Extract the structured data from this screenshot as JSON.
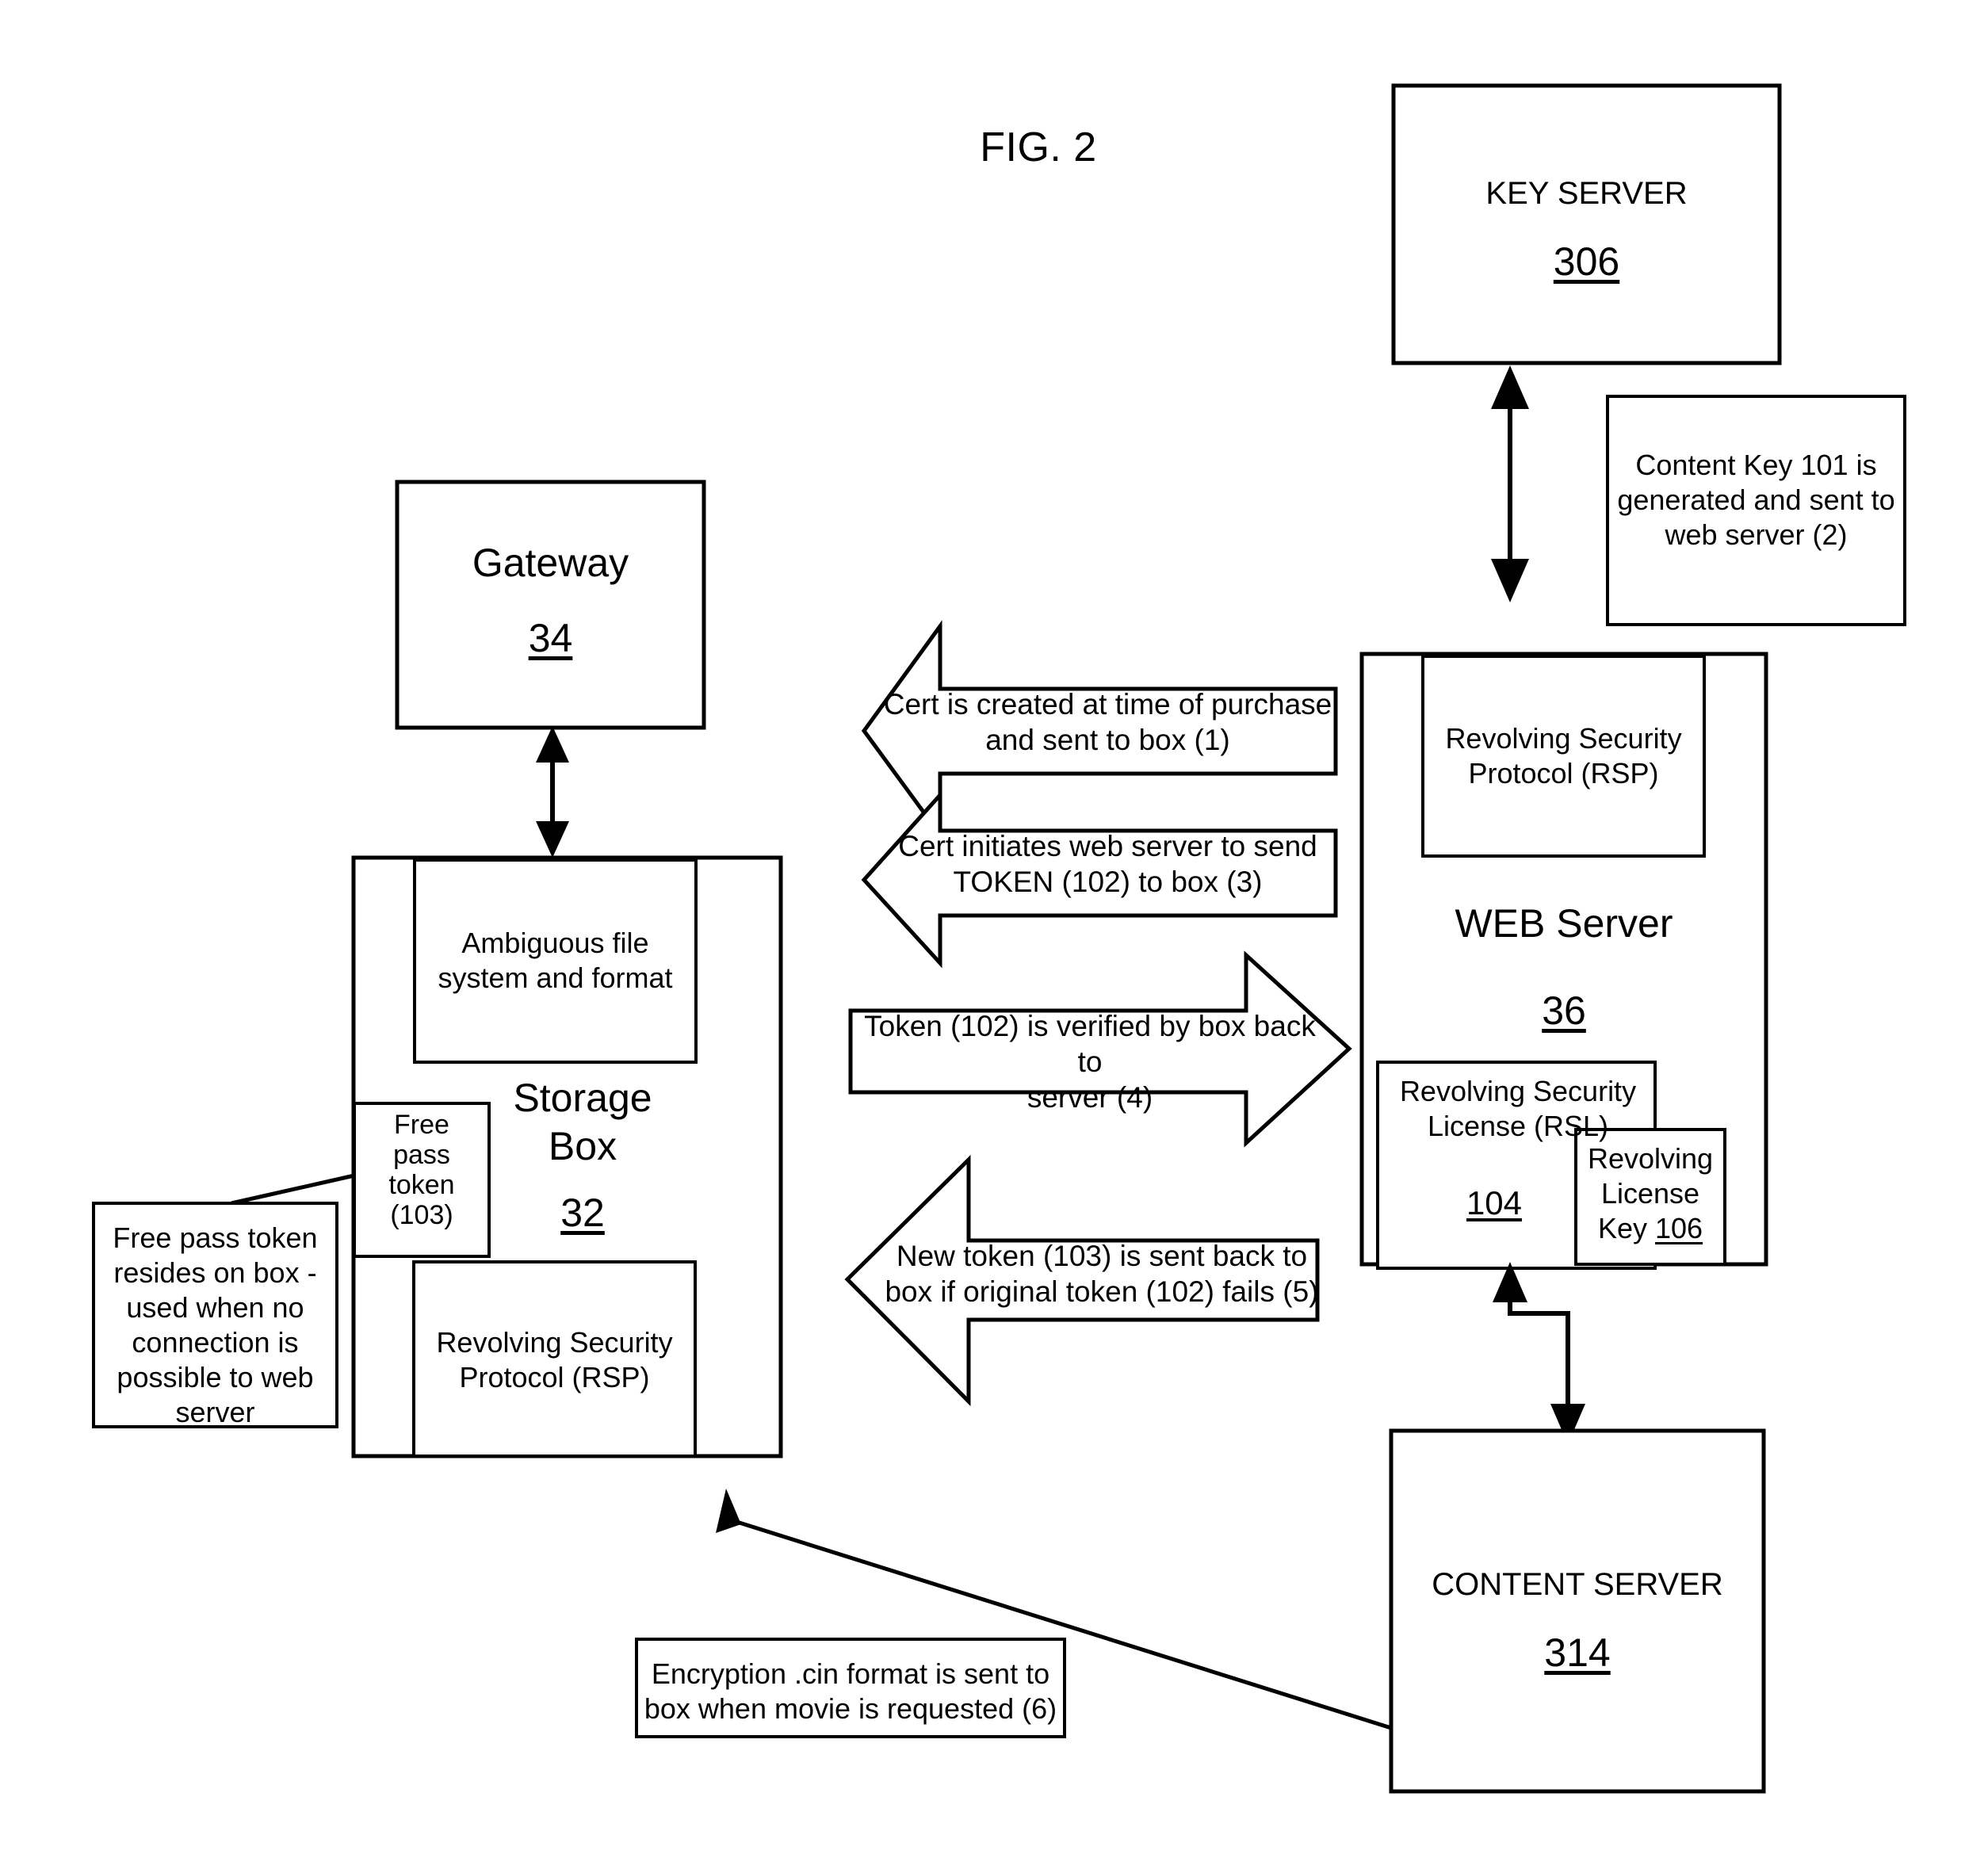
{
  "figure": {
    "title": "FIG. 2"
  },
  "nodes": {
    "key_server": {
      "label": "KEY SERVER",
      "ref": "306"
    },
    "gateway": {
      "label": "Gateway",
      "ref": "34"
    },
    "storage_box": {
      "label": "Storage\nBox",
      "ref": "32",
      "ambiguous_fs": "Ambiguous file\nsystem and format",
      "rsp": "Revolving Security\nProtocol (RSP)",
      "free_pass_token": "Free\npass\ntoken\n(103)"
    },
    "web_server": {
      "label": "WEB Server",
      "ref": "36",
      "rsp": "Revolving Security\nProtocol (RSP)",
      "rsl_label": "Revolving Security\nLicense (RSL)",
      "rsl_ref": "104",
      "license_key_label": "Revolving\nLicense\nKey ",
      "license_key_ref": "106"
    },
    "content_server": {
      "label": "CONTENT SERVER",
      "ref": "314"
    }
  },
  "notes": {
    "content_key": "Content Key 101 is\ngenerated and sent to\nweb server (2)",
    "free_pass": "Free pass token\nresides on box -\nused when no\nconnection is\npossible to web\nserver",
    "encryption": "Encryption .cin format is sent to\nbox when movie is requested (6)"
  },
  "flow_callouts": [
    {
      "step": "1",
      "direction": "left",
      "text": "Cert is created at time of purchase\nand sent to box (1)"
    },
    {
      "step": "3",
      "direction": "left",
      "text": "Cert initiates web server to send\nTOKEN (102) to box (3)"
    },
    {
      "step": "4",
      "direction": "right",
      "text": "Token (102) is verified by box back to\nserver (4)"
    },
    {
      "step": "5",
      "direction": "left",
      "text": "New token (103) is sent back to\nbox if original token (102) fails (5)"
    }
  ],
  "colors": {
    "stroke": "#000000",
    "fill": "#ffffff"
  }
}
